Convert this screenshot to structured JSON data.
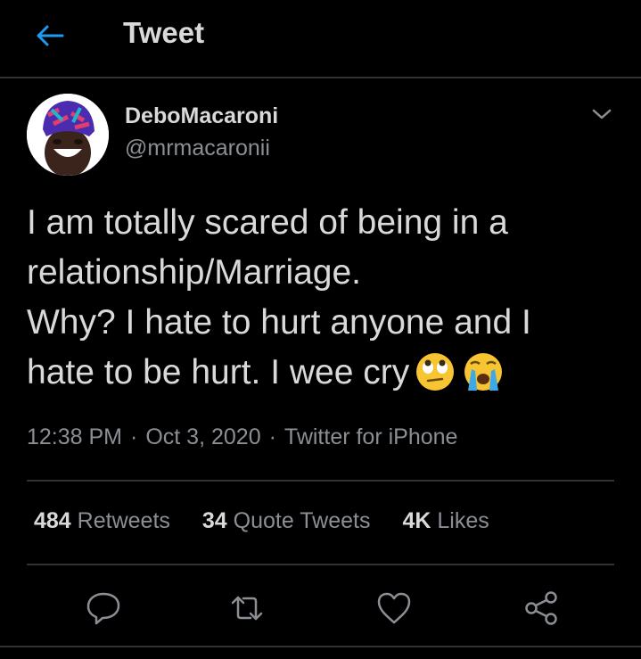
{
  "header": {
    "title": "Tweet"
  },
  "author": {
    "display_name": "DeboMacaroni",
    "handle": "@mrmacaronii"
  },
  "tweet": {
    "lines": [
      "I am totally scared of being in a",
      "relationship/Marriage.",
      "Why? I hate to hurt anyone and I",
      "hate to be hurt. I wee cry"
    ],
    "emojis": [
      "eye-roll-emoji",
      "crying-emoji"
    ]
  },
  "meta": {
    "time": "12:38 PM",
    "date": "Oct 3, 2020",
    "source": "Twitter for iPhone",
    "separator": "·"
  },
  "stats": {
    "retweets_count": "484",
    "retweets_label": "Retweets",
    "quotes_count": "34",
    "quotes_label": "Quote Tweets",
    "likes_count": "4K",
    "likes_label": "Likes"
  },
  "colors": {
    "background": "#000000",
    "text": "#d9d9d9",
    "muted": "#8b8f94",
    "accent": "#1d9bf0",
    "divider": "#2f3336"
  },
  "icons": [
    "back-arrow-icon",
    "chevron-down-icon",
    "reply-icon",
    "retweet-icon",
    "like-icon",
    "share-icon"
  ]
}
